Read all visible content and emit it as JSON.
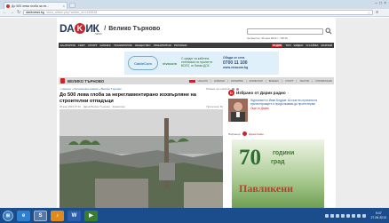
{
  "browser": {
    "tab_title": "До 500 лева глоба за не...",
    "tab_close": "×",
    "url_domain": "dariknews.bg",
    "url_path": "/view_article.php?article_id=1159538"
  },
  "site": {
    "logo_left": "DA",
    "logo_k": "K",
    "logo_right": "ИК",
    "logo_sub": "NEWS",
    "slash": "/",
    "city": "Велико Търново",
    "dateline": "Четвъртък, 30 юни 2013 г. / 08:15",
    "nav": [
      "България",
      "Свят",
      "Спорт",
      "Бизнес",
      "Технологии",
      "Общество",
      "Любопитно",
      "Региони"
    ],
    "nav_right": [
      "Радио",
      "Топ",
      "Видео",
      "Я сайфа",
      "Всички"
    ],
    "nav_active_index": 0
  },
  "ad": {
    "brand": "CableCom",
    "vivo": "vivacom",
    "text": "С кредит за кабелна телевизия по пролетта ВСЕО, от банка ДСК",
    "right_top": "Обади се сега",
    "phone": "0700 11 100",
    "site": "www.vivacom.bg"
  },
  "citybar": {
    "name": "ВЕЛИКО ТЪРНОВО",
    "links": [
      "Начало",
      "Новини",
      "Интервю",
      "Коментар",
      "Бизнес",
      "Спорт",
      "Театър",
      "Справочник"
    ]
  },
  "article": {
    "crumb_home": "Начало",
    "crumb_mid": "Регионални новини",
    "crumb_city": "Велико Търново",
    "tools": "Размер на шрифта:",
    "headline": "До 500 лева глоба за нерегламентирано изхвърляне на строителни отпадъци",
    "date": "30 юни 2013 07:31",
    "author": "Дарик Велико Търново",
    "comments": "Коментари",
    "views": "Прочетена: 62"
  },
  "sidebar": {
    "circle": "D",
    "title": "Избрано от Дарик радио",
    "pick_text": "Журналистът Иван Бедров: Аз съм на страната на протестиращите и продължавам да протестирам",
    "pick_link": "Още от Дарик",
    "partner": "Партньор:",
    "partner_name": "Дарик Кафе"
  },
  "banner": {
    "num": "70",
    "g1": "години",
    "g2": "град",
    "g3": "Павликени"
  },
  "taskbar": {
    "start": "⊞",
    "apps": [
      "e",
      "S",
      "♪",
      "W",
      "▶"
    ],
    "time": "9:47",
    "date": "27.06.2013"
  }
}
